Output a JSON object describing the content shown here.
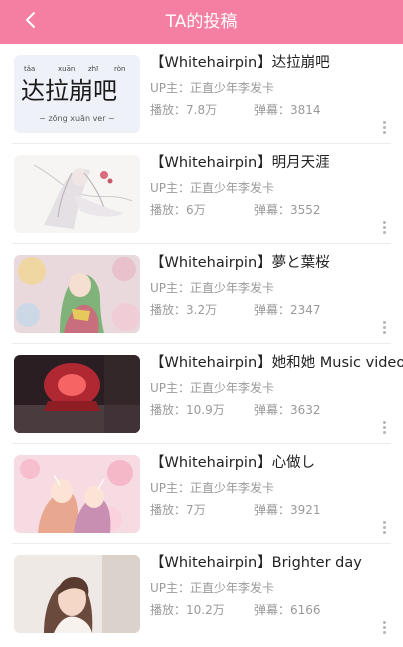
{
  "header": {
    "title": "TA的投稿"
  },
  "videos": [
    {
      "title": "【Whitehairpin】达拉崩吧",
      "uploader_label": "UP主：",
      "uploader": "正直少年李发卡",
      "plays_label": "播放：",
      "plays": "7.8万",
      "danmaku_label": "弹幕：",
      "danmaku": "3814",
      "thumb_pinyin": [
        "tǎa",
        "xuān",
        "zhī",
        "ròn"
      ],
      "thumb_chars": "达拉崩吧",
      "thumb_caption": "~ zōng xuān ver ~"
    },
    {
      "title": "【Whitehairpin】明月天涯",
      "uploader_label": "UP主：",
      "uploader": "正直少年李发卡",
      "plays_label": "播放：",
      "plays": "6万",
      "danmaku_label": "弹幕：",
      "danmaku": "3552"
    },
    {
      "title": "【Whitehairpin】夢と葉桜",
      "uploader_label": "UP主：",
      "uploader": "正直少年李发卡",
      "plays_label": "播放：",
      "plays": "3.2万",
      "danmaku_label": "弹幕：",
      "danmaku": "2347"
    },
    {
      "title": "【Whitehairpin】她和她 Music video",
      "uploader_label": "UP主：",
      "uploader": "正直少年李发卡",
      "plays_label": "播放：",
      "plays": "10.9万",
      "danmaku_label": "弹幕：",
      "danmaku": "3632"
    },
    {
      "title": "【Whitehairpin】心做し",
      "uploader_label": "UP主：",
      "uploader": "正直少年李发卡",
      "plays_label": "播放：",
      "plays": "7万",
      "danmaku_label": "弹幕：",
      "danmaku": "3921"
    },
    {
      "title": "【Whitehairpin】Brighter day",
      "uploader_label": "UP主：",
      "uploader": "正直少年李发卡",
      "plays_label": "播放：",
      "plays": "10.2万",
      "danmaku_label": "弹幕：",
      "danmaku": "6166"
    }
  ],
  "colors": {
    "header_bg": "#f47fa3",
    "title_text": "#222222",
    "meta_text": "#9a9a9a"
  },
  "icons": {
    "back": "chevron-left-icon",
    "more": "more-vertical-icon"
  }
}
